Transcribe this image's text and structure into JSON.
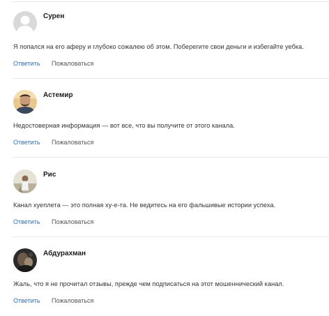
{
  "comments": [
    {
      "author": "Сурен",
      "avatar_icon": "default-user-icon",
      "text": "Я попался на его аферу и глубоко сожалею об этом. Поберегите свои деньги и избегайте уебка.",
      "reply_label": "Ответить",
      "report_label": "Пожаловаться"
    },
    {
      "author": "Астемир",
      "avatar_icon": "user-photo",
      "text": "Недостоверная информация — вот все, что вы получите от этого канала.",
      "reply_label": "Ответить",
      "report_label": "Пожаловаться"
    },
    {
      "author": "Рис",
      "avatar_icon": "user-photo",
      "text": "Канал хуеплета — это полная ху-е-та. Не ведитесь на его фальшивые истории успеха.",
      "reply_label": "Ответить",
      "report_label": "Пожаловаться"
    },
    {
      "author": "Абдурахман",
      "avatar_icon": "user-photo",
      "text": "Жаль, что я не прочитал отзывы, прежде чем подписаться на этот мошеннический канал.",
      "reply_label": "Ответить",
      "report_label": "Пожаловаться"
    }
  ],
  "colors": {
    "link": "#2f6fb7",
    "divider": "#e8e8e8",
    "author": "#1a1a1a"
  }
}
